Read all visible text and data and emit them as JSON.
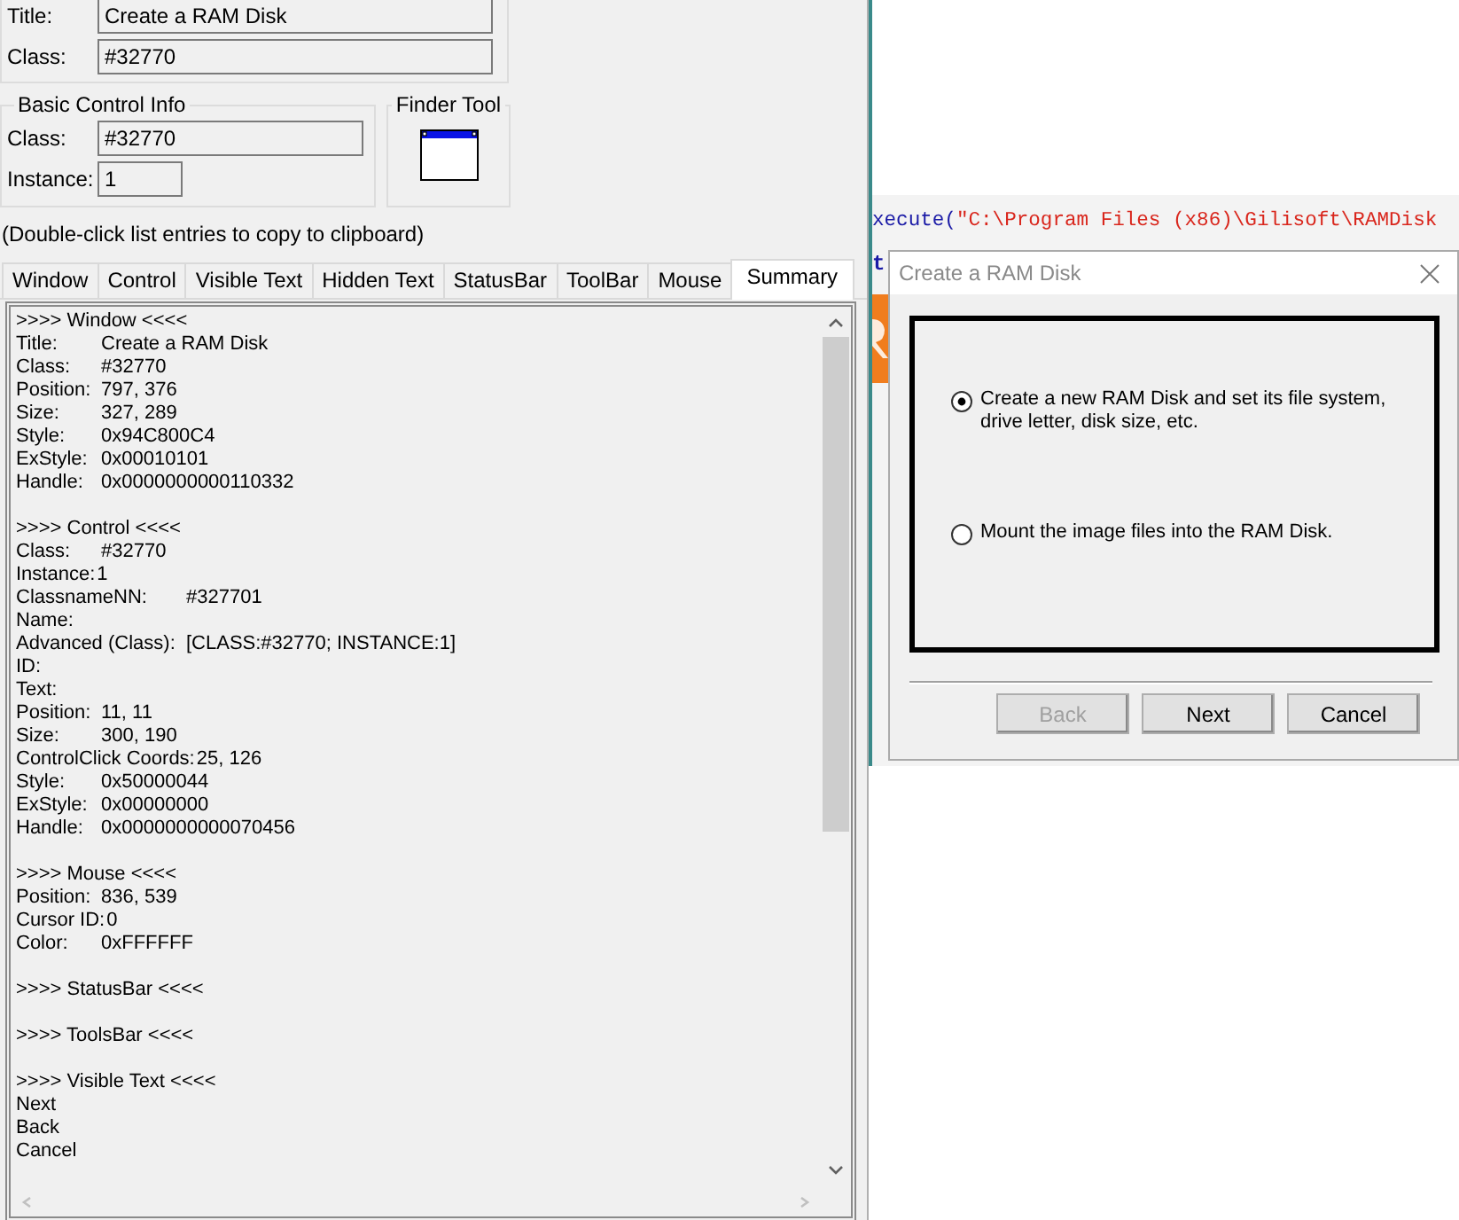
{
  "window_info": {
    "fields": [
      {
        "label": "Title:",
        "value": "Create a RAM Disk"
      },
      {
        "label": "Class:",
        "value": "#32770"
      }
    ]
  },
  "basic_control_info": {
    "title": "Basic Control Info",
    "fields": [
      {
        "label": "Class:",
        "value": "#32770",
        "kind": "wide"
      },
      {
        "label": "Instance:",
        "value": "1",
        "kind": "narrow"
      }
    ]
  },
  "finder_tool": {
    "title": "Finder Tool"
  },
  "hint": "(Double-click list entries to copy to clipboard)",
  "tabs": [
    {
      "label": "Window",
      "selected": false
    },
    {
      "label": "Control",
      "selected": false
    },
    {
      "label": "Visible Text",
      "selected": false
    },
    {
      "label": "Hidden Text",
      "selected": false
    },
    {
      "label": "StatusBar",
      "selected": false
    },
    {
      "label": "ToolBar",
      "selected": false
    },
    {
      "label": "Mouse",
      "selected": false
    },
    {
      "label": "Summary",
      "selected": true
    }
  ],
  "summary": {
    "lines": [
      {
        "kind": "header",
        "text": ">>>> Window <<<<"
      },
      {
        "kind": "field",
        "label": "Title:",
        "value": "Create a RAM Disk"
      },
      {
        "kind": "field",
        "label": "Class:",
        "value": "#32770"
      },
      {
        "kind": "field",
        "label": "Position:",
        "value": "797, 376"
      },
      {
        "kind": "field",
        "label": "Size:",
        "value": "327, 289"
      },
      {
        "kind": "field",
        "label": "Style:",
        "value": "0x94C800C4"
      },
      {
        "kind": "field",
        "label": "ExStyle:",
        "value": "0x00010101"
      },
      {
        "kind": "field",
        "label": "Handle:",
        "value": "0x0000000000110332"
      },
      {
        "kind": "blank"
      },
      {
        "kind": "header",
        "text": ">>>> Control <<<<"
      },
      {
        "kind": "field",
        "label": "Class:",
        "value": "#32770"
      },
      {
        "kind": "inline",
        "label": "Instance:",
        "value": "1"
      },
      {
        "kind": "wide",
        "label": "ClassnameNN:",
        "value": "#327701"
      },
      {
        "kind": "field",
        "label": "Name:"
      },
      {
        "kind": "wide",
        "label": "Advanced (Class):",
        "value": "[CLASS:#32770; INSTANCE:1]"
      },
      {
        "kind": "field",
        "label": "ID:"
      },
      {
        "kind": "field",
        "label": "Text:"
      },
      {
        "kind": "field",
        "label": "Position:",
        "value": "11, 11"
      },
      {
        "kind": "field",
        "label": "Size:",
        "value": "300, 190"
      },
      {
        "kind": "inline",
        "label": "ControlClick Coords:",
        "value": "25, 126"
      },
      {
        "kind": "field",
        "label": "Style:",
        "value": "0x50000044"
      },
      {
        "kind": "field",
        "label": "ExStyle:",
        "value": "0x00000000"
      },
      {
        "kind": "field",
        "label": "Handle:",
        "value": "0x0000000000070456"
      },
      {
        "kind": "blank"
      },
      {
        "kind": "header",
        "text": ">>>> Mouse <<<<"
      },
      {
        "kind": "field",
        "label": "Position:",
        "value": "836, 539"
      },
      {
        "kind": "inline",
        "label": "Cursor ID:",
        "value": "0"
      },
      {
        "kind": "field",
        "label": "Color:",
        "value": "0xFFFFFF"
      },
      {
        "kind": "blank"
      },
      {
        "kind": "header",
        "text": ">>>> StatusBar <<<<"
      },
      {
        "kind": "blank"
      },
      {
        "kind": "header",
        "text": ">>>> ToolsBar <<<<"
      },
      {
        "kind": "blank"
      },
      {
        "kind": "header",
        "text": ">>>> Visible Text <<<<"
      },
      {
        "kind": "text",
        "text": "Next"
      },
      {
        "kind": "text",
        "text": "Back"
      },
      {
        "kind": "text",
        "text": "Cancel"
      }
    ]
  },
  "editor": {
    "code_line": [
      {
        "kind": "function",
        "text": "xecute("
      },
      {
        "kind": "string",
        "text": "\"C:\\Program Files (x86)\\Gilisoft\\RAMDisk"
      }
    ],
    "cut_text": "t"
  },
  "dialog": {
    "title": "Create a RAM Disk",
    "options": [
      {
        "label": "Create a new RAM Disk and set its file system, drive letter, disk size, etc.",
        "selected": true
      },
      {
        "label": "Mount the image files into the RAM Disk.",
        "selected": false
      }
    ],
    "buttons": [
      {
        "label": "Back",
        "disabled": true
      },
      {
        "label": "Next",
        "disabled": false
      },
      {
        "label": "Cancel",
        "disabled": false
      }
    ]
  }
}
